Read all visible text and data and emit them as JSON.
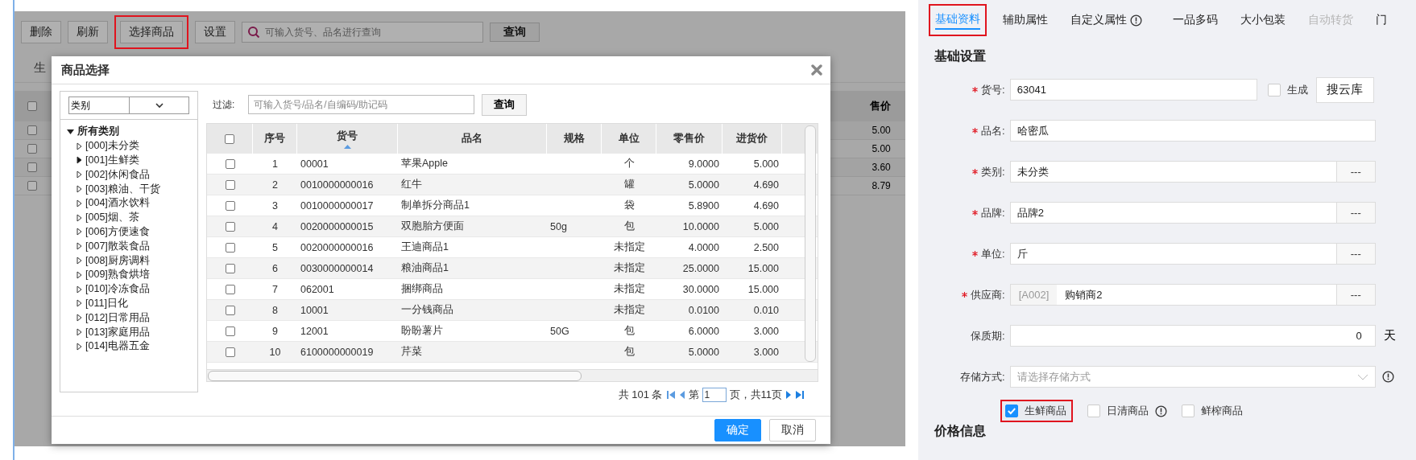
{
  "toolbar": {
    "buttons": [
      {
        "label": "删除",
        "highlighted": false
      },
      {
        "label": "刷新",
        "highlighted": false
      },
      {
        "label": "选择商品",
        "highlighted": true
      },
      {
        "label": "设置",
        "highlighted": false
      }
    ],
    "search": {
      "placeholder": "可输入货号、品名进行查询"
    },
    "search_button": "查询"
  },
  "background_list": {
    "tab": "生",
    "price_header": "售价",
    "all_checked": false,
    "rows": [
      {
        "checked": false,
        "price": "5.00"
      },
      {
        "checked": false,
        "price": "5.00"
      },
      {
        "checked": false,
        "price": "3.60"
      },
      {
        "checked": false,
        "price": "8.79"
      }
    ]
  },
  "dialog": {
    "title": "商品选择",
    "category_select": {
      "value": "类别"
    },
    "tree": {
      "label": "所有类别",
      "expanded": true,
      "children": [
        {
          "label": "[000]未分类",
          "hovered": false
        },
        {
          "label": "[001]生鲜类",
          "hovered": true
        },
        {
          "label": "[002]休闲食品",
          "hovered": false
        },
        {
          "label": "[003]粮油、干货",
          "hovered": false
        },
        {
          "label": "[004]酒水饮料",
          "hovered": false
        },
        {
          "label": "[005]烟、茶",
          "hovered": false
        },
        {
          "label": "[006]方便速食",
          "hovered": false
        },
        {
          "label": "[007]散装食品",
          "hovered": false
        },
        {
          "label": "[008]厨房调料",
          "hovered": false
        },
        {
          "label": "[009]熟食烘培",
          "hovered": false
        },
        {
          "label": "[010]冷冻食品",
          "hovered": false
        },
        {
          "label": "[011]日化",
          "hovered": false
        },
        {
          "label": "[012]日常用品",
          "hovered": false
        },
        {
          "label": "[013]家庭用品",
          "hovered": false
        },
        {
          "label": "[014]电器五金",
          "hovered": false
        }
      ]
    },
    "filter": {
      "label": "过滤:",
      "placeholder": "可输入货号/品名/自编码/助记码",
      "button": "查询"
    },
    "table": {
      "all_checked": false,
      "columns": [
        {
          "label": "序号",
          "sorted": false
        },
        {
          "label": "货号",
          "sorted": true
        },
        {
          "label": "品名",
          "sorted": false
        },
        {
          "label": "规格",
          "sorted": false
        },
        {
          "label": "单位",
          "sorted": false
        },
        {
          "label": "零售价",
          "sorted": false
        },
        {
          "label": "进货价",
          "sorted": false
        }
      ],
      "rows": [
        {
          "checked": false,
          "index": "1",
          "code": "00001",
          "name": "苹果Apple",
          "unit": "个",
          "retail": "9.0000",
          "purchase": "5.000"
        },
        {
          "checked": false,
          "index": "2",
          "code": "0010000000016",
          "name": "红牛",
          "unit": "罐",
          "retail": "5.0000",
          "purchase": "4.690"
        },
        {
          "checked": false,
          "index": "3",
          "code": "0010000000017",
          "name": "制单拆分商品1",
          "unit": "袋",
          "retail": "5.8900",
          "purchase": "4.690"
        },
        {
          "checked": false,
          "index": "4",
          "code": "0020000000015",
          "name": "双胞胎方便面",
          "spec": "50g",
          "unit": "包",
          "retail": "10.0000",
          "purchase": "5.000"
        },
        {
          "checked": false,
          "index": "5",
          "code": "0020000000016",
          "name": "王迪商品1",
          "unit": "未指定",
          "retail": "4.0000",
          "purchase": "2.500"
        },
        {
          "checked": false,
          "index": "6",
          "code": "0030000000014",
          "name": "粮油商品1",
          "unit": "未指定",
          "retail": "25.0000",
          "purchase": "15.000"
        },
        {
          "checked": false,
          "index": "7",
          "code": "062001",
          "name": "捆绑商品",
          "unit": "未指定",
          "retail": "30.0000",
          "purchase": "15.000"
        },
        {
          "checked": false,
          "index": "8",
          "code": "10001",
          "name": "一分钱商品",
          "unit": "未指定",
          "retail": "0.0100",
          "purchase": "0.010"
        },
        {
          "checked": false,
          "index": "9",
          "code": "12001",
          "name": "盼盼薯片",
          "spec": "50G",
          "unit": "包",
          "retail": "6.0000",
          "purchase": "3.000"
        },
        {
          "checked": false,
          "index": "10",
          "code": "6100000000019",
          "name": "芹菜",
          "unit": "包",
          "retail": "5.0000",
          "purchase": "3.000"
        }
      ]
    },
    "pagination": {
      "total": "共 101 条",
      "page_prefix": "第",
      "page": "1",
      "page_suffix": "页，共11页"
    },
    "buttons": [
      {
        "label": "确定",
        "kind": "primary"
      },
      {
        "label": "取消",
        "kind": "default"
      }
    ]
  },
  "detail_panel": {
    "tabs": [
      {
        "label": "基础资料",
        "selected": true,
        "disabled": false,
        "highlighted": true,
        "info": false
      },
      {
        "label": "辅助属性",
        "selected": false,
        "disabled": false,
        "highlighted": false,
        "info": false
      },
      {
        "label": "自定义属性",
        "selected": false,
        "disabled": false,
        "highlighted": false,
        "info": true
      },
      {
        "label": "一品多码",
        "selected": false,
        "disabled": false,
        "highlighted": false,
        "info": false
      },
      {
        "label": "大小包装",
        "selected": false,
        "disabled": false,
        "highlighted": false,
        "info": false
      },
      {
        "label": "自动转货",
        "selected": false,
        "disabled": true,
        "highlighted": false,
        "info": false
      },
      {
        "label": "门",
        "selected": false,
        "disabled": false,
        "highlighted": false,
        "info": false
      }
    ],
    "section_title": "基础设置",
    "fields": [
      {
        "kind": "code",
        "label": "货号:",
        "required": true,
        "value": "63041",
        "checkbox": {
          "label": "生成",
          "checked": false
        },
        "button": "搜云库"
      },
      {
        "kind": "text",
        "label": "品名:",
        "required": true,
        "value": "哈密瓜"
      },
      {
        "kind": "picker",
        "label": "类别:",
        "required": true,
        "value": "未分类",
        "button": "---"
      },
      {
        "kind": "picker",
        "label": "品牌:",
        "required": true,
        "value": "品牌2",
        "button": "---"
      },
      {
        "kind": "picker",
        "label": "单位:",
        "required": true,
        "value": "斤",
        "button": "---"
      },
      {
        "kind": "picker",
        "label": "供应商:",
        "required": true,
        "prefix": "[A002]",
        "value": "购销商2",
        "button": "---"
      },
      {
        "kind": "number",
        "label": "保质期:",
        "required": false,
        "value": "0",
        "unit": "天"
      },
      {
        "kind": "select",
        "label": "存储方式:",
        "required": false,
        "placeholder": "请选择存储方式"
      }
    ],
    "options": [
      {
        "label": "生鲜商品",
        "checked": true,
        "highlighted": true,
        "info": false
      },
      {
        "label": "日清商品",
        "checked": false,
        "highlighted": false,
        "info": true
      },
      {
        "label": "鲜榨商品",
        "checked": false,
        "highlighted": false,
        "info": false
      }
    ],
    "next_section_title": "价格信息"
  }
}
